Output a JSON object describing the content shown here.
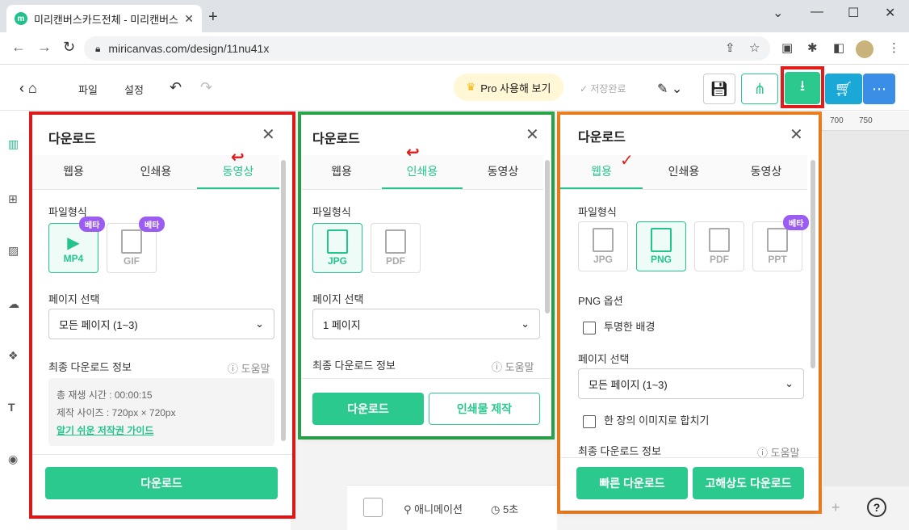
{
  "browser": {
    "tab_title": "미리캔버스카드전체 - 미리캔버스",
    "tab_close": "✕",
    "new_tab": "+",
    "url": "miricanvas.com/design/11nu41x",
    "win_min": "—",
    "win_max": "☐",
    "win_close": "✕",
    "win_chevron": "⌄"
  },
  "header": {
    "file": "파일",
    "settings": "설정",
    "pro": "Pro 사용해 보기",
    "saved": "저장완료"
  },
  "ruler": {
    "t700": "700",
    "t750": "750"
  },
  "bottom": {
    "anim": "애니메이션",
    "time": "5초",
    "help": "?"
  },
  "panel_video": {
    "title": "다운로드",
    "tabs": [
      "웹용",
      "인쇄용",
      "동영상"
    ],
    "file_type_label": "파일형식",
    "formats": [
      {
        "name": "MP4",
        "badge": "베타"
      },
      {
        "name": "GIF",
        "badge": "베타"
      }
    ],
    "page_select_label": "페이지 선택",
    "page_select_value": "모든 페이지 (1~3)",
    "info_label": "최종 다운로드 정보",
    "help": "도움말",
    "info_line1": "총 재생 시간 : 00:00:15",
    "info_line2": "제작 사이즈 : 720px × 720px",
    "guide_link": "알기 쉬운 저작권 가이드",
    "download_button": "다운로드"
  },
  "panel_print": {
    "title": "다운로드",
    "tabs": [
      "웹용",
      "인쇄용",
      "동영상"
    ],
    "file_type_label": "파일형식",
    "formats": [
      {
        "name": "JPG"
      },
      {
        "name": "PDF"
      }
    ],
    "page_select_label": "페이지 선택",
    "page_select_value": "1 페이지",
    "info_label": "최종 다운로드 정보",
    "help": "도움말",
    "download_button": "다운로드",
    "print_button": "인쇄물 제작"
  },
  "panel_web": {
    "title": "다운로드",
    "tabs": [
      "웹용",
      "인쇄용",
      "동영상"
    ],
    "file_type_label": "파일형식",
    "formats": [
      {
        "name": "JPG"
      },
      {
        "name": "PNG"
      },
      {
        "name": "PDF"
      },
      {
        "name": "PPT",
        "badge": "베타"
      }
    ],
    "png_options_label": "PNG 옵션",
    "transparent_bg": "투명한 배경",
    "page_select_label": "페이지 선택",
    "page_select_value": "모든 페이지 (1~3)",
    "merge_label": "한 장의 이미지로 합치기",
    "info_label": "최종 다운로드 정보",
    "help": "도움말",
    "fast_download": "빠른 다운로드",
    "hq_download": "고해상도 다운로드"
  },
  "colors": {
    "accent": "#2cc98f",
    "red_frame": "#e21b1b",
    "green_frame": "#2aa84a",
    "orange_frame": "#f07f22",
    "beta": "#9b5cf2"
  }
}
